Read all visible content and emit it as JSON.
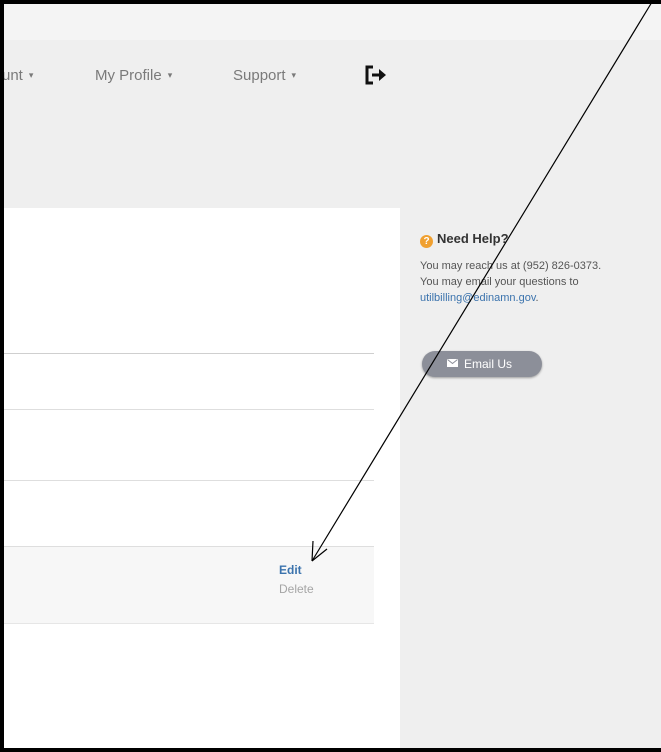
{
  "nav": {
    "items": [
      {
        "label": "unt",
        "caret": "▾"
      },
      {
        "label": "My Profile",
        "caret": "▾"
      },
      {
        "label": "Support",
        "caret": "▾"
      }
    ],
    "logout_icon": "sign-out-icon"
  },
  "list_row": {
    "edit_label": "Edit",
    "delete_label": "Delete"
  },
  "help": {
    "title": "Need Help?",
    "icon": "help-circle-icon",
    "phone_line": "You may reach us at (952) 826-0373.",
    "email_line": "You may email your questions to",
    "email_address": "utilbilling@edinamn.gov",
    "email_suffix": ".",
    "button_label": "Email Us",
    "button_icon": "envelope-icon"
  },
  "colors": {
    "link": "#3b73ad",
    "help_icon": "#f0a030",
    "button_bg": "#8c8f99",
    "panel_bg": "#efefef"
  }
}
